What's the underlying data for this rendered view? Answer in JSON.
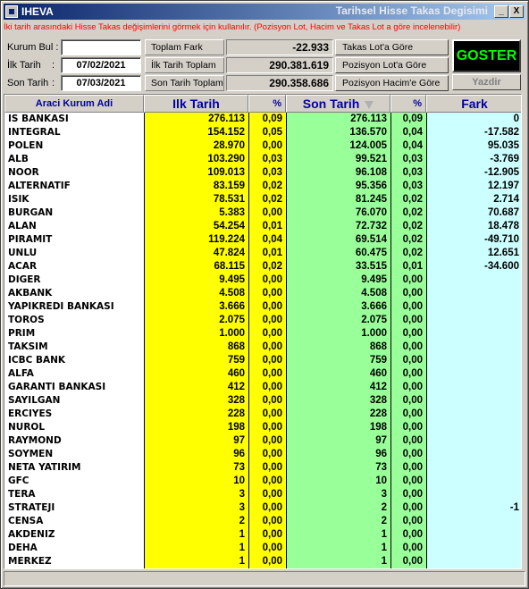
{
  "titlebar": {
    "app_name": "IHEVA",
    "window_title": "Tarihsel Hisse Takas Degisimi",
    "minimize_label": "_",
    "close_label": "X"
  },
  "info_text": "İki tarih arasındaki Hisse Takas değişimlerini görmek için kullanılır. (Pozisyon Lot, Hacim ve Takas Lot a göre incelenebilir)",
  "filters": {
    "kurum_bul_label": "Kurum Bul :",
    "kurum_bul_value": "",
    "ilk_tarih_label": "İlk Tarih",
    "ilk_tarih_value": "07/02/2021",
    "son_tarih_label": "Son Tarih",
    "son_tarih_value": "07/03/2021",
    "colon": ":"
  },
  "stats": {
    "toplam_fark_label": "Toplam Fark",
    "toplam_fark_value": "-22.933",
    "ilk_tarih_toplam_label": "İlk Tarih Toplam",
    "ilk_tarih_toplam_value": "290.381.619",
    "son_tarih_toplam_label": "Son Tarih Toplam",
    "son_tarih_toplam_value": "290.358.686"
  },
  "options": {
    "takas_lot": "Takas Lot'a Göre",
    "pozisyon_lot": "Pozisyon Lot'a Göre",
    "pozisyon_hacim": "Pozisyon Hacim'e Göre"
  },
  "buttons": {
    "goster": "GOSTER",
    "yazdir": "Yazdir"
  },
  "colors": {
    "ilk_tarih_bg": "#ffff00",
    "son_tarih_bg": "#99ff99",
    "fark_bg": "#ccffff",
    "info_text": "#ff0000",
    "goster_text": "#00ff00"
  },
  "table": {
    "headers": {
      "name": "Araci Kurum Adi",
      "ilk": "Ilk Tarih",
      "pct1": "%",
      "son": "Son Tarih",
      "pct2": "%",
      "fark": "Fark"
    },
    "rows": [
      {
        "name": "IS BANKASI",
        "ilk": "276.113",
        "p1": "0,09",
        "son": "276.113",
        "p2": "0,09",
        "fark": "0"
      },
      {
        "name": "INTEGRAL",
        "ilk": "154.152",
        "p1": "0,05",
        "son": "136.570",
        "p2": "0,04",
        "fark": "-17.582"
      },
      {
        "name": "POLEN",
        "ilk": "28.970",
        "p1": "0,00",
        "son": "124.005",
        "p2": "0,04",
        "fark": "95.035"
      },
      {
        "name": "ALB",
        "ilk": "103.290",
        "p1": "0,03",
        "son": "99.521",
        "p2": "0,03",
        "fark": "-3.769"
      },
      {
        "name": "NOOR",
        "ilk": "109.013",
        "p1": "0,03",
        "son": "96.108",
        "p2": "0,03",
        "fark": "-12.905"
      },
      {
        "name": "ALTERNATIF",
        "ilk": "83.159",
        "p1": "0,02",
        "son": "95.356",
        "p2": "0,03",
        "fark": "12.197"
      },
      {
        "name": "ISIK",
        "ilk": "78.531",
        "p1": "0,02",
        "son": "81.245",
        "p2": "0,02",
        "fark": "2.714"
      },
      {
        "name": "BURGAN",
        "ilk": "5.383",
        "p1": "0,00",
        "son": "76.070",
        "p2": "0,02",
        "fark": "70.687"
      },
      {
        "name": "ALAN",
        "ilk": "54.254",
        "p1": "0,01",
        "son": "72.732",
        "p2": "0,02",
        "fark": "18.478"
      },
      {
        "name": "PIRAMIT",
        "ilk": "119.224",
        "p1": "0,04",
        "son": "69.514",
        "p2": "0,02",
        "fark": "-49.710"
      },
      {
        "name": "UNLU",
        "ilk": "47.824",
        "p1": "0,01",
        "son": "60.475",
        "p2": "0,02",
        "fark": "12.651"
      },
      {
        "name": "ACAR",
        "ilk": "68.115",
        "p1": "0,02",
        "son": "33.515",
        "p2": "0,01",
        "fark": "-34.600"
      },
      {
        "name": "DIGER",
        "ilk": "9.495",
        "p1": "0,00",
        "son": "9.495",
        "p2": "0,00",
        "fark": ""
      },
      {
        "name": "AKBANK",
        "ilk": "4.508",
        "p1": "0,00",
        "son": "4.508",
        "p2": "0,00",
        "fark": ""
      },
      {
        "name": "YAPIKREDI BANKASI",
        "ilk": "3.666",
        "p1": "0,00",
        "son": "3.666",
        "p2": "0,00",
        "fark": ""
      },
      {
        "name": "TOROS",
        "ilk": "2.075",
        "p1": "0,00",
        "son": "2.075",
        "p2": "0,00",
        "fark": ""
      },
      {
        "name": "PRIM",
        "ilk": "1.000",
        "p1": "0,00",
        "son": "1.000",
        "p2": "0,00",
        "fark": ""
      },
      {
        "name": "TAKSIM",
        "ilk": "868",
        "p1": "0,00",
        "son": "868",
        "p2": "0,00",
        "fark": ""
      },
      {
        "name": "ICBC BANK",
        "ilk": "759",
        "p1": "0,00",
        "son": "759",
        "p2": "0,00",
        "fark": ""
      },
      {
        "name": "ALFA",
        "ilk": "460",
        "p1": "0,00",
        "son": "460",
        "p2": "0,00",
        "fark": ""
      },
      {
        "name": "GARANTI BANKASI",
        "ilk": "412",
        "p1": "0,00",
        "son": "412",
        "p2": "0,00",
        "fark": ""
      },
      {
        "name": "SAYILGAN",
        "ilk": "328",
        "p1": "0,00",
        "son": "328",
        "p2": "0,00",
        "fark": ""
      },
      {
        "name": "ERCIYES",
        "ilk": "228",
        "p1": "0,00",
        "son": "228",
        "p2": "0,00",
        "fark": ""
      },
      {
        "name": "NUROL",
        "ilk": "198",
        "p1": "0,00",
        "son": "198",
        "p2": "0,00",
        "fark": ""
      },
      {
        "name": "RAYMOND",
        "ilk": "97",
        "p1": "0,00",
        "son": "97",
        "p2": "0,00",
        "fark": ""
      },
      {
        "name": "SOYMEN",
        "ilk": "96",
        "p1": "0,00",
        "son": "96",
        "p2": "0,00",
        "fark": ""
      },
      {
        "name": "NETA YATIRIM",
        "ilk": "73",
        "p1": "0,00",
        "son": "73",
        "p2": "0,00",
        "fark": ""
      },
      {
        "name": "GFC",
        "ilk": "10",
        "p1": "0,00",
        "son": "10",
        "p2": "0,00",
        "fark": ""
      },
      {
        "name": "TERA",
        "ilk": "3",
        "p1": "0,00",
        "son": "3",
        "p2": "0,00",
        "fark": ""
      },
      {
        "name": "STRATEJI",
        "ilk": "3",
        "p1": "0,00",
        "son": "2",
        "p2": "0,00",
        "fark": "-1"
      },
      {
        "name": "CENSA",
        "ilk": "2",
        "p1": "0,00",
        "son": "2",
        "p2": "0,00",
        "fark": ""
      },
      {
        "name": "AKDENIZ",
        "ilk": "1",
        "p1": "0,00",
        "son": "1",
        "p2": "0,00",
        "fark": ""
      },
      {
        "name": "DEHA",
        "ilk": "1",
        "p1": "0,00",
        "son": "1",
        "p2": "0,00",
        "fark": ""
      },
      {
        "name": "MERKEZ",
        "ilk": "1",
        "p1": "0,00",
        "son": "1",
        "p2": "0,00",
        "fark": ""
      }
    ]
  }
}
